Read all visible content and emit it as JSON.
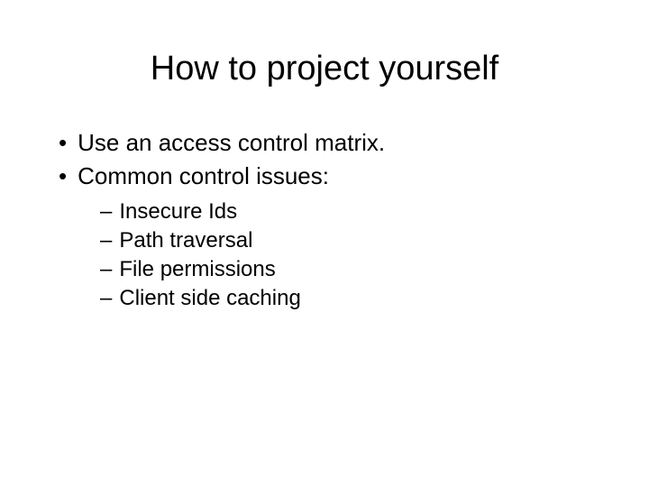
{
  "slide": {
    "title": "How to project yourself",
    "bullets": [
      {
        "text": "Use an access control matrix."
      },
      {
        "text": "Common control issues:"
      }
    ],
    "subbullets": [
      {
        "text": "Insecure Ids"
      },
      {
        "text": "Path traversal"
      },
      {
        "text": "File permissions"
      },
      {
        "text": "Client side caching"
      }
    ]
  }
}
